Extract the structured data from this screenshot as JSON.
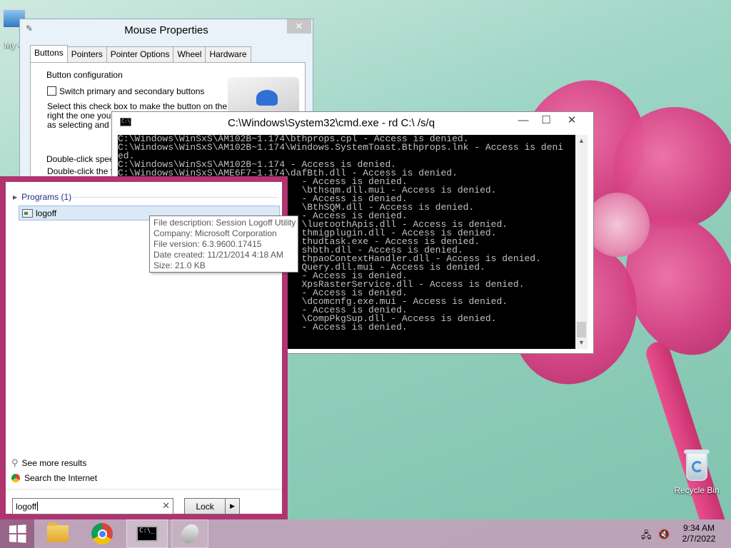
{
  "desktop": {
    "icon_my_computer_label": "My C",
    "icon_recycle_bin_label": "Recycle Bin"
  },
  "mouse_properties": {
    "title": "Mouse Properties",
    "close_glyph": "✕",
    "tabs": [
      {
        "label": "Buttons",
        "active": true
      },
      {
        "label": "Pointers"
      },
      {
        "label": "Pointer Options"
      },
      {
        "label": "Wheel"
      },
      {
        "label": "Hardware"
      }
    ],
    "button_config_label": "Button configuration",
    "switch_checkbox_label": "Switch primary and secondary buttons",
    "description_lines": [
      "Select this check box to make the button on the",
      "right the one you us",
      "as selecting and dra"
    ],
    "double_click_label": "Double-click speed",
    "double_click_desc": "Double-click the fol"
  },
  "cmd": {
    "title": "C:\\Windows\\System32\\cmd.exe - rd  C:\\ /s/q",
    "icon_text": "C:\\",
    "minimize_glyph": "—",
    "maximize_glyph": "☐",
    "close_glyph": "✕",
    "lines": [
      "C:\\Windows\\WinSxS\\AM102B~1.174\\bthprops.cpl - Access is denied.",
      "C:\\Windows\\WinSxS\\AM102B~1.174\\Windows.SystemToast.Bthprops.lnk - Access is deni",
      "ed.",
      "C:\\Windows\\WinSxS\\AM102B~1.174 - Access is denied.",
      "C:\\Windows\\WinSxS\\AME6F7~1.174\\dafBth.dll - Access is denied.",
      "                                 - Access is denied.",
      "                                 \\bthsqm.dll.mui - Access is denied.",
      "                                 - Access is denied.",
      "                                 \\BthSQM.dll - Access is denied.",
      "                                 - Access is denied.",
      "                                 \\luetoothApis.dll - Access is denied.",
      "                                 thmigplugin.dll - Access is denied.",
      "                                 thudtask.exe - Access is denied.",
      "                                 shbth.dll - Access is denied.",
      "                                 thpaoContextHandler.dll - Access is denied.",
      "                                 Query.dll.mui - Access is denied.",
      "                                 - Access is denied.",
      "                                 XpsRasterService.dll - Access is denied.",
      "                                 - Access is denied.",
      "                                 \\dcomcnfg.exe.mui - Access is denied.",
      "                                 - Access is denied.",
      "                                 \\CompPkgSup.dll - Access is denied.",
      "                                 - Access is denied."
    ]
  },
  "search_panel": {
    "section_label": "Programs (1)",
    "result_label": "logoff",
    "see_more_label": "See more results",
    "search_internet_label": "Search the Internet",
    "search_value": "logoff",
    "clear_glyph": "✕",
    "lock_label": "Lock",
    "lock_arrow_glyph": "▶"
  },
  "tooltip": {
    "lines": [
      "File description: Session Logoff Utility",
      "Company: Microsoft Corporation",
      "File version: 6.3.9600.17415",
      "Date created: 11/21/2014 4:18 AM",
      "Size: 21.0 KB"
    ]
  },
  "taskbar": {
    "cmd_icon_text": "C:\\_",
    "time": "9:34 AM",
    "date": "2/7/2022"
  },
  "icons": {
    "start": "windows-logo",
    "explorer": "folder-icon",
    "browser": "chrome-icon",
    "cmd": "cmd-icon",
    "mouse": "mouse-icon",
    "network": "network-icon",
    "volume": "volume-muted-icon"
  },
  "colors": {
    "start_panel": "#b0346f",
    "taskbar": "#c69dba",
    "console_bg": "#000000",
    "console_text": "#c0c0c0",
    "selection": "#dbe8f6"
  }
}
